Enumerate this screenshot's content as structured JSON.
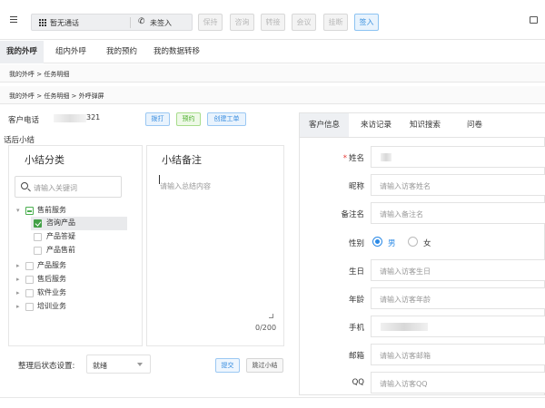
{
  "toolbar": {
    "status": "暂无通话",
    "sign_status": "未签入",
    "buttons": [
      "保持",
      "咨询",
      "转接",
      "会议",
      "挂断"
    ],
    "signin": "签入"
  },
  "tabs": [
    "我的外呼",
    "组内外呼",
    "我的预约",
    "我的数据转移"
  ],
  "breadcrumb1": "我的外呼 > 任务明细",
  "breadcrumb2": "我的外呼 > 任务明细 > 外呼弹屏",
  "left": {
    "phone_label": "客户电话",
    "phone_tail": "321",
    "actions": [
      "拨打",
      "预约",
      "创建工单"
    ],
    "summary_title": "话后小结",
    "category_title": "小结分类",
    "search_placeholder": "请输入关键词",
    "tree": {
      "presales": "售前服务",
      "consult": "咨询产品",
      "qa": "产品答疑",
      "sale": "产品售前",
      "product": "产品服务",
      "aftersales": "售后服务",
      "software": "软件业务",
      "training": "培训业务"
    },
    "notes_title": "小结备注",
    "notes_placeholder": "请输入总结内容",
    "counter": "0/200",
    "status_label": "整理后状态设置:",
    "status_value": "就绪",
    "submit": "提交",
    "skip": "跳过小结"
  },
  "right": {
    "tabs": [
      "客户信息",
      "来访记录",
      "知识搜索",
      "问卷"
    ],
    "fields": {
      "name": "姓名",
      "nickname": "昵称",
      "nickname_ph": "请输入访客姓名",
      "remark": "备注名",
      "remark_ph": "请输入备注名",
      "gender": "性别",
      "male": "男",
      "female": "女",
      "birthday": "生日",
      "birthday_ph": "请输入访客生日",
      "age": "年龄",
      "age_ph": "请输入访客年龄",
      "phone": "手机",
      "email": "邮箱",
      "email_ph": "请输入访客邮箱",
      "qq": "QQ",
      "qq_ph": "请输入访客QQ"
    }
  }
}
